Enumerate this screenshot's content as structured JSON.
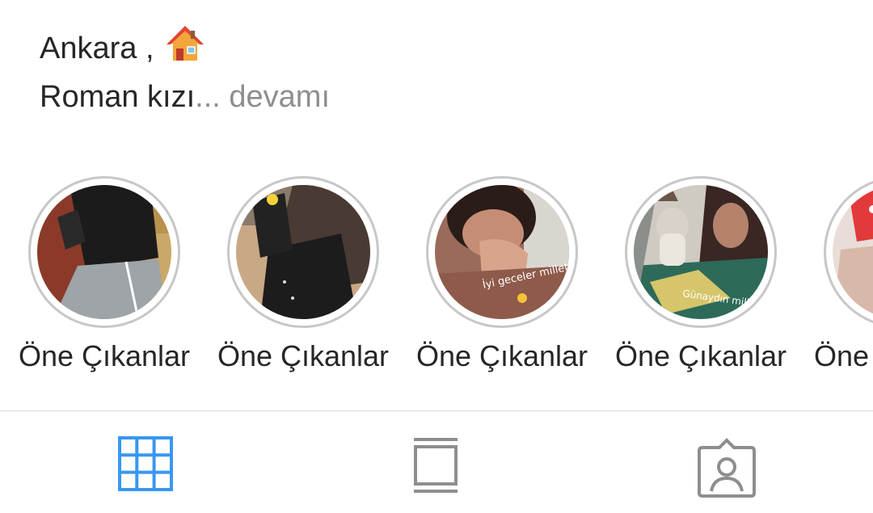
{
  "bio": {
    "line1": "Ankara ,",
    "line1_emoji": "house-emoji",
    "line2_text": "Roman kızı",
    "line2_more": "... devamı"
  },
  "highlights": [
    {
      "label": "Öne Çıkanlar",
      "overlay_text": ""
    },
    {
      "label": "Öne Çıkanlar",
      "overlay_text": ""
    },
    {
      "label": "Öne Çıkanlar",
      "overlay_text": "İyi geceler millet"
    },
    {
      "label": "Öne Çıkanlar",
      "overlay_text": "Günaydın millet"
    },
    {
      "label": "Öne Çıkanlar",
      "overlay_text": ""
    }
  ],
  "tabs": [
    {
      "name": "grid-tab",
      "icon": "grid-icon",
      "active": true
    },
    {
      "name": "feed-tab",
      "icon": "feed-icon",
      "active": false
    },
    {
      "name": "tagged-tab",
      "icon": "tagged-person-icon",
      "active": false
    }
  ],
  "colors": {
    "active_tab": "#3897f0",
    "inactive_tab": "#8e8e8e",
    "ring": "#c7c7c7",
    "text": "#262626",
    "muted": "#8e8e8e"
  }
}
